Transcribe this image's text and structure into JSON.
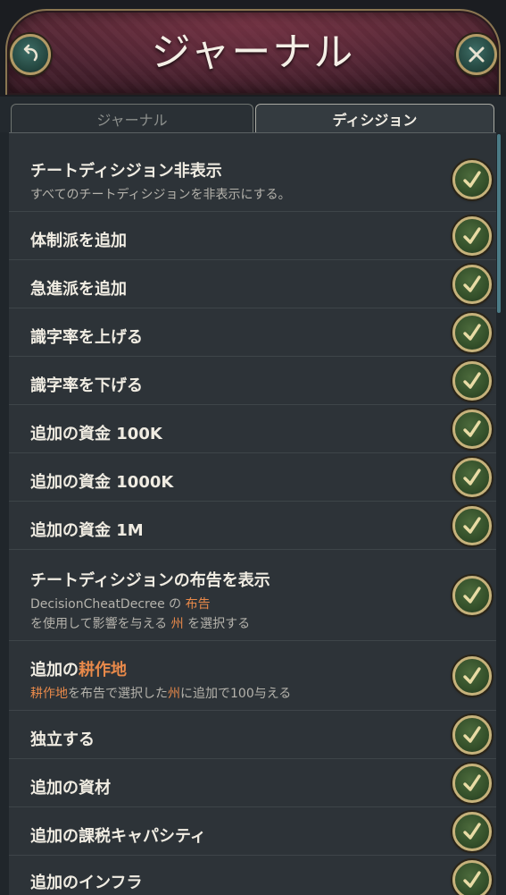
{
  "header": {
    "title": "ジャーナル",
    "back_icon": "back-arrow-icon",
    "close_icon": "close-icon"
  },
  "tabs": [
    {
      "label": "ジャーナル",
      "active": false
    },
    {
      "label": "ディシジョン",
      "active": true
    }
  ],
  "decisions": [
    {
      "name": "チートディシジョン非表示",
      "desc": "すべてのチートディシジョンを非表示にする。"
    },
    {
      "name": "体制派を追加"
    },
    {
      "name": "急進派を追加"
    },
    {
      "name": "識字率を上げる"
    },
    {
      "name": "識字率を下げる"
    },
    {
      "name": "追加の資金 100K"
    },
    {
      "name": "追加の資金 1000K"
    },
    {
      "name": "追加の資金 1M"
    },
    {
      "name": "チートディシジョンの布告を表示",
      "desc_line1": {
        "a": "DecisionCheatDecree の ",
        "hl": "布告"
      },
      "desc_line2": {
        "a": "を使用して影響を与える ",
        "hl": "州",
        "b": " を選択する"
      }
    },
    {
      "name_prefix": "追加の",
      "name_hl": "耕作地",
      "desc": {
        "hl1": "耕作地",
        "a": "を布告で選択した",
        "hl2": "州",
        "b": "に追加で100与える"
      }
    },
    {
      "name": "独立する"
    },
    {
      "name": "追加の資材"
    },
    {
      "name": "追加の課税キャパシティ"
    },
    {
      "name": "追加のインフラ"
    }
  ],
  "colors": {
    "highlight": "#e8894a",
    "check_fill": "#34502a",
    "gold_ring": "#c6b27b",
    "banner": "#4a2230"
  }
}
